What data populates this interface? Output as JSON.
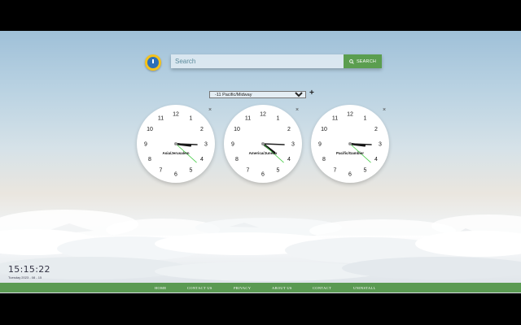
{
  "search": {
    "placeholder": "Search",
    "button_label": "SEARCH",
    "button_icon": "search-icon"
  },
  "timezone_select": {
    "selected": "-11 Pacific/Midway",
    "add_label": "+"
  },
  "clocks": [
    {
      "timezone": "Asia/Jerusalem",
      "hour": 3,
      "minute": 15,
      "second": 22
    },
    {
      "timezone": "America/Juneau",
      "hour": 4,
      "minute": 15,
      "second": 22
    },
    {
      "timezone": "Pacific/Gambier",
      "hour": 3,
      "minute": 15,
      "second": 22
    }
  ],
  "dial_numbers": [
    "12",
    "1",
    "2",
    "3",
    "4",
    "5",
    "6",
    "7",
    "8",
    "9",
    "10",
    "11"
  ],
  "close_label": "×",
  "current_time": "15:15:22",
  "current_date": "Tuesday 2023 - 08 - 15",
  "footer": {
    "links": [
      "HOME",
      "CONTACT US",
      "PRIVACY",
      "ABOUT US",
      "CONTACT",
      "UNINSTALL"
    ]
  },
  "colors": {
    "accent_green": "#5b9e4f",
    "second_hand": "#44cc44",
    "logo_yellow": "#f4c21b",
    "logo_blue": "#2d6fb8"
  }
}
